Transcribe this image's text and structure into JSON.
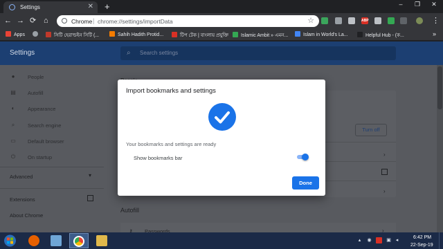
{
  "browser": {
    "tab": {
      "title": "Settings",
      "favicon": "gear-icon"
    },
    "new_tab": "+",
    "window_controls": {
      "minimize": "–",
      "restore": "❐",
      "close": "✕"
    },
    "nav": {
      "back": "←",
      "forward": "→",
      "reload": "⟳",
      "home": "⌂"
    },
    "omnibox": {
      "host": "Chrome",
      "separator": "|",
      "path": "chrome://settings/importData",
      "star": "☆"
    },
    "extensions": [
      {
        "name": "extension-green",
        "color": "#3ba55c"
      },
      {
        "name": "extension-gray",
        "color": "#9aa0a6"
      },
      {
        "name": "extension-headset",
        "color": "#bdc1c6"
      },
      {
        "name": "extension-adblock",
        "color": "#d93025",
        "label": "ABP"
      },
      {
        "name": "extension-shield",
        "color": "#bdc1c6"
      },
      {
        "name": "extension-mail",
        "color": "#34a853"
      },
      {
        "name": "extension-folder",
        "color": "#5f6368"
      },
      {
        "name": "profile-avatar",
        "color": "#7c8c57"
      }
    ],
    "menu": "⋮"
  },
  "bookmarks": {
    "items": [
      {
        "label": "Apps",
        "color": "#ea4335"
      },
      {
        "label": "",
        "color": "#9aa0a6"
      },
      {
        "label": "সিটি হেরাল্ডইন সিটি (...",
        "color": "#c0392b"
      },
      {
        "label": "Sahih Hadith Protid...",
        "color": "#f57c00"
      },
      {
        "label": "টিপ টেক | বাংলায় প্রযুক্তি",
        "color": "#d93025"
      },
      {
        "label": "Islamic Ambit » এমন...",
        "color": "#34a853"
      },
      {
        "label": "Islam in World's La...",
        "color": "#4285f4"
      },
      {
        "label": "Helpful Hub - (ক...",
        "color": "#202124"
      }
    ],
    "more": "»"
  },
  "settings": {
    "title": "Settings",
    "search_placeholder": "Search settings",
    "nav_items": [
      {
        "label": "People",
        "icon": "person-icon"
      },
      {
        "label": "Autofill",
        "icon": "clipboard-icon"
      },
      {
        "label": "Appearance",
        "icon": "palette-icon"
      },
      {
        "label": "Search engine",
        "icon": "search-icon"
      },
      {
        "label": "Default browser",
        "icon": "browser-icon"
      },
      {
        "label": "On startup",
        "icon": "power-icon"
      }
    ],
    "advanced": "Advanced",
    "extensions": "Extensions",
    "about": "About Chrome",
    "people_heading": "People",
    "turn_off": "Turn off",
    "autofill_heading": "Autofill",
    "passwords": "Passwords"
  },
  "dialog": {
    "title": "Import bookmarks and settings",
    "message": "Your bookmarks and settings are ready",
    "option": "Show bookmarks bar",
    "option_enabled": true,
    "done": "Done",
    "accent": "#1a73e8"
  },
  "taskbar": {
    "apps": [
      {
        "name": "firefox",
        "color": "#e66000"
      },
      {
        "name": "control-panel",
        "color": "#6fa6d6"
      },
      {
        "name": "chrome",
        "color": "#4285f4"
      },
      {
        "name": "file-explorer",
        "color": "#e0b84b"
      }
    ],
    "time": "6:42 PM",
    "date": "22-Sep-19"
  }
}
